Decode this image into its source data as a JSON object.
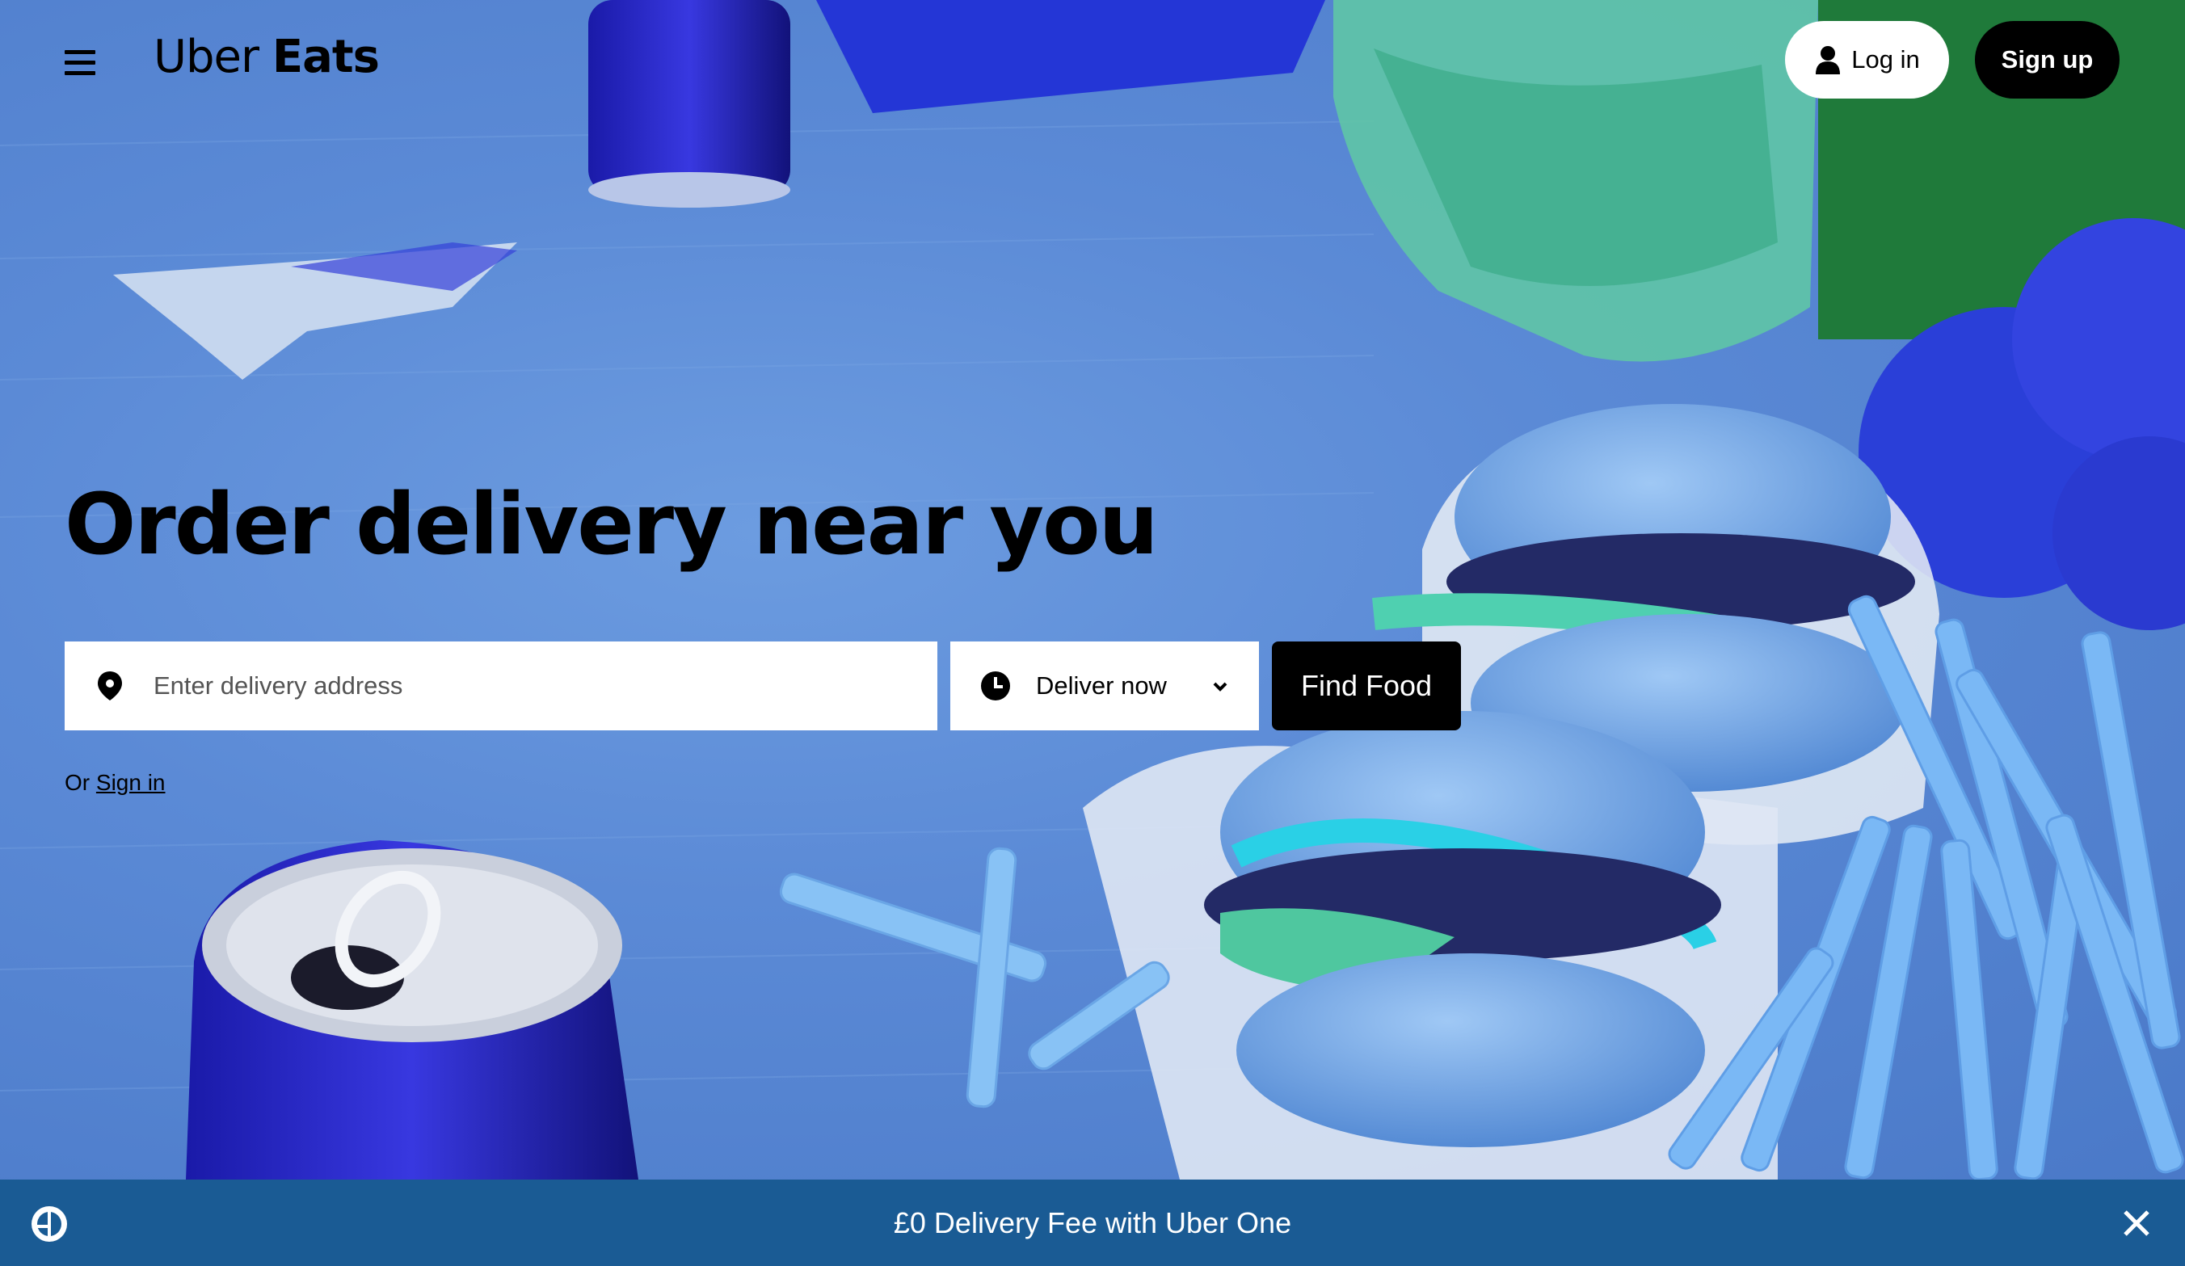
{
  "header": {
    "logo_light": "Uber",
    "logo_bold": "Eats",
    "login_label": "Log in",
    "signup_label": "Sign up"
  },
  "hero": {
    "headline": "Order delivery near you",
    "address_placeholder": "Enter delivery address",
    "deliver_label": "Deliver now",
    "find_label": "Find Food",
    "or_text": "Or",
    "signin_link": "Sign in"
  },
  "banner": {
    "text": "£0 Delivery Fee with Uber One"
  },
  "icons": {
    "menu": "menu-icon",
    "user": "user-icon",
    "pin": "location-pin-icon",
    "clock": "clock-icon",
    "chevron": "chevron-down-icon",
    "uber_one": "uber-one-icon",
    "close": "close-icon"
  },
  "colors": {
    "banner": "#1a5b94",
    "hero_blue": "#5b8ad6",
    "primary": "#000000",
    "white": "#ffffff"
  }
}
